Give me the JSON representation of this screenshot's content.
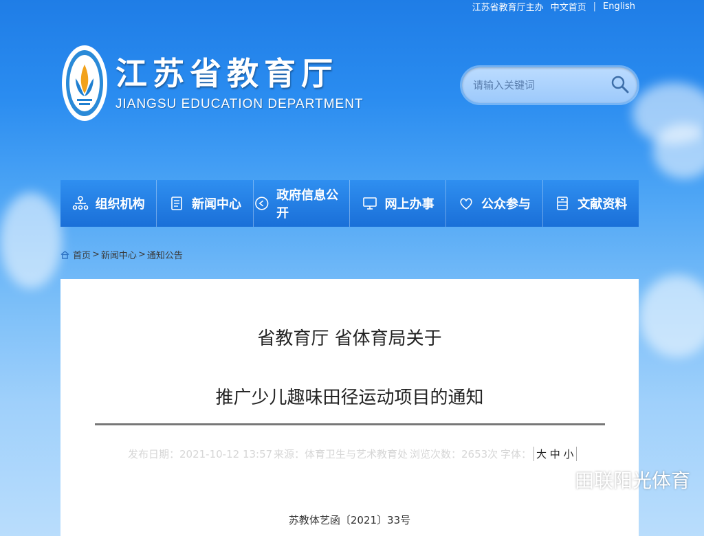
{
  "top_links": {
    "host": "江苏省教育厅主办",
    "home": "中文首页",
    "sep": "|",
    "english": "English"
  },
  "logo": {
    "cn": "江苏省教育厅",
    "en": "JIANGSU EDUCATION DEPARTMENT"
  },
  "search": {
    "placeholder": "请输入关键词"
  },
  "nav": {
    "items": [
      {
        "label": "组织机构",
        "icon": "org-chart-icon"
      },
      {
        "label": "新闻中心",
        "icon": "document-icon"
      },
      {
        "label": "政府信息公开",
        "icon": "play-circle-icon"
      },
      {
        "label": "网上办事",
        "icon": "monitor-icon"
      },
      {
        "label": "公众参与",
        "icon": "heart-icon"
      },
      {
        "label": "文献资料",
        "icon": "archive-icon"
      }
    ]
  },
  "breadcrumb": {
    "home": "首页",
    "sep1": ">",
    "news": "新闻中心",
    "sep2": ">",
    "current": "通知公告"
  },
  "article": {
    "title_line1": "省教育厅 省体育局关于",
    "title_line2": "推广少儿趣味田径运动项目的通知",
    "publish": "发布日期：2021-10-12 13:57",
    "source": "来源：体育卫生与艺术教育处",
    "views": "浏览次数：2653次",
    "font_label": "字体：",
    "font_options": "大 中 小",
    "doc_number": "苏教体艺函〔2021〕33号"
  },
  "watermark": {
    "text": "田联阳光体育"
  },
  "colors": {
    "nav_bg": "#1f79e0",
    "accent": "#2a8cf0"
  }
}
